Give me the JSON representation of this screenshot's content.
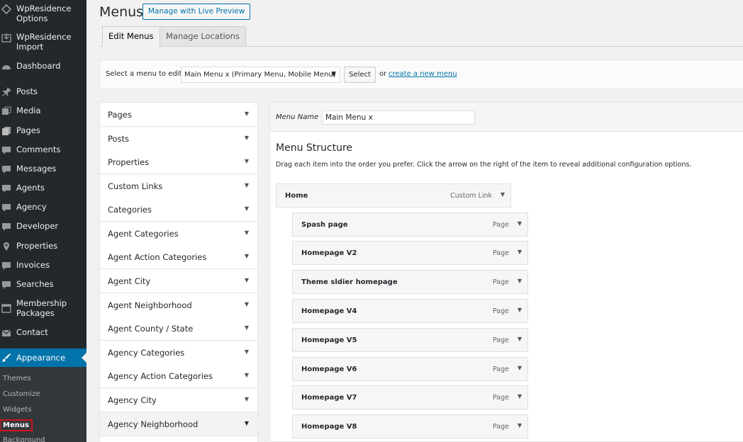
{
  "sidebar": {
    "items": [
      {
        "label1": "WpResidence",
        "label2": "Options",
        "icon": "diamond-icon"
      },
      {
        "label1": "WpResidence",
        "label2": "Import",
        "icon": "import-icon"
      },
      {
        "label1": "Dashboard",
        "icon": "dashboard-icon"
      },
      {
        "label1": "Posts",
        "icon": "pin-icon"
      },
      {
        "label1": "Media",
        "icon": "media-icon"
      },
      {
        "label1": "Pages",
        "icon": "pages-icon"
      },
      {
        "label1": "Comments",
        "icon": "comment-icon"
      },
      {
        "label1": "Messages",
        "icon": "message-icon"
      },
      {
        "label1": "Agents",
        "icon": "agent-icon"
      },
      {
        "label1": "Agency",
        "icon": "agency-icon"
      },
      {
        "label1": "Developer",
        "icon": "developer-icon"
      },
      {
        "label1": "Properties",
        "icon": "location-icon"
      },
      {
        "label1": "Invoices",
        "icon": "invoice-icon"
      },
      {
        "label1": "Searches",
        "icon": "search-icon"
      },
      {
        "label1": "Membership",
        "label2": "Packages",
        "icon": "calendar-icon"
      },
      {
        "label1": "Contact",
        "icon": "mail-icon"
      },
      {
        "label1": "Appearance",
        "icon": "brush-icon"
      }
    ],
    "submenu": [
      "Themes",
      "Customize",
      "Widgets",
      "Menus",
      "Background"
    ]
  },
  "header": {
    "title": "Menus",
    "live_preview": "Manage with Live Preview",
    "tabs": [
      "Edit Menus",
      "Manage Locations"
    ]
  },
  "select_bar": {
    "label": "Select a menu to edit:",
    "selected": "Main Menu x (Primary Menu, Mobile Menu)",
    "button": "Select",
    "or": "or",
    "create_link": "create a new menu",
    "dot": "."
  },
  "accordion": [
    "Pages",
    "Posts",
    "Properties",
    "Custom Links",
    "Categories",
    "Agent Categories",
    "Agent Action Categories",
    "Agent City",
    "Agent Neighborhood",
    "Agent County / State",
    "Agency Categories",
    "Agency Action Categories",
    "Agency City",
    "Agency Neighborhood"
  ],
  "menu_edit": {
    "name_label": "Menu Name",
    "name_value": "Main Menu x",
    "structure_title": "Menu Structure",
    "structure_desc": "Drag each item into the order you prefer. Click the arrow on the right of the item to reveal additional configuration options.",
    "items": [
      {
        "title": "Home",
        "kind": "Custom Link",
        "depth": 0
      },
      {
        "title": "Spash page",
        "kind": "Page",
        "depth": 1
      },
      {
        "title": "Homepage V2",
        "kind": "Page",
        "depth": 1
      },
      {
        "title": "Theme sldier homepage",
        "kind": "Page",
        "depth": 1
      },
      {
        "title": "Homepage V4",
        "kind": "Page",
        "depth": 1
      },
      {
        "title": "Homepage V5",
        "kind": "Page",
        "depth": 1
      },
      {
        "title": "Homepage V6",
        "kind": "Page",
        "depth": 1
      },
      {
        "title": "Homepage V7",
        "kind": "Page",
        "depth": 1
      },
      {
        "title": "Homepage V8",
        "kind": "Page",
        "depth": 1
      }
    ]
  },
  "colors": {
    "sidebar_bg": "#23282d",
    "accent": "#0073aa",
    "highlight": "#d0141a"
  }
}
